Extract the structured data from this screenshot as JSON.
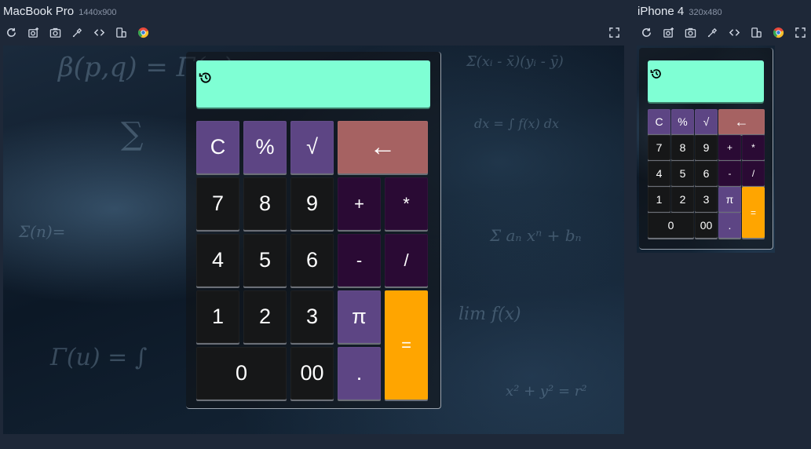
{
  "devices": [
    {
      "name": "MacBook Pro",
      "dimensions": "1440x900"
    },
    {
      "name": "iPhone 4",
      "dimensions": "320x480"
    }
  ],
  "toolbar_icons": [
    "reload-icon",
    "screenshot-plus-icon",
    "camera-icon",
    "eyedropper-icon",
    "code-icon",
    "copy-layout-icon",
    "chrome-icon"
  ],
  "fullscreen_icon": "fullscreen-icon",
  "calculator": {
    "display_value": "",
    "history_icon": "history-icon",
    "keys": {
      "clear": "C",
      "percent": "%",
      "sqrt": "√",
      "backspace": "←",
      "seven": "7",
      "eight": "8",
      "nine": "9",
      "plus": "+",
      "multiply": "*",
      "four": "4",
      "five": "5",
      "six": "6",
      "minus": "-",
      "divide": "/",
      "one": "1",
      "two": "2",
      "three": "3",
      "pi": "π",
      "equals": "=",
      "zero": "0",
      "double_zero": "00",
      "decimal": "."
    }
  },
  "colors": {
    "page_background": "#1e2838",
    "display": "#7fffd4",
    "number_key": "#161718",
    "operator_key": "#2a0a34",
    "function_key": "#5d4584",
    "backspace_key": "#a66262",
    "equals_key": "#ffa500"
  }
}
